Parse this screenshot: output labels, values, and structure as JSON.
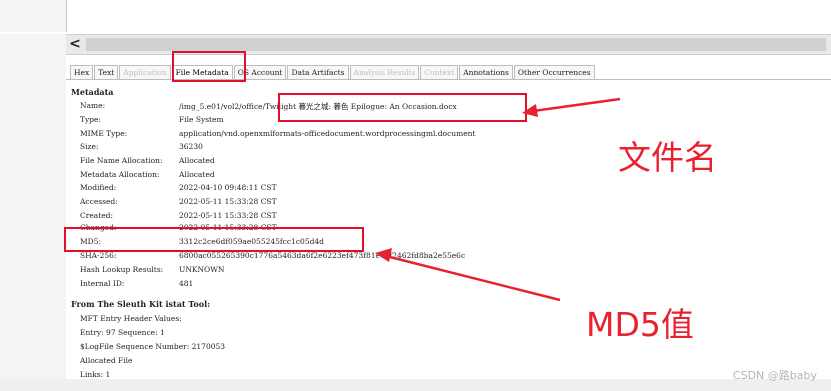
{
  "tabs": [
    {
      "label": "Hex",
      "state": "normal"
    },
    {
      "label": "Text",
      "state": "normal"
    },
    {
      "label": "Application",
      "state": "disabled"
    },
    {
      "label": "File Metadata",
      "state": "active"
    },
    {
      "label": "OS Account",
      "state": "normal"
    },
    {
      "label": "Data Artifacts",
      "state": "normal"
    },
    {
      "label": "Analysis Results",
      "state": "disabled"
    },
    {
      "label": "Context",
      "state": "disabled"
    },
    {
      "label": "Annotations",
      "state": "normal"
    },
    {
      "label": "Other Occurrences",
      "state": "normal"
    }
  ],
  "scroll_left_glyph": "<",
  "metadata": {
    "heading": "Metadata",
    "name_label": "Name:",
    "name_path": "/img_5.e01/vol2/office/",
    "name_file": "Twilight 暮光之城: 暮色 Epilogue: An Occasion.docx",
    "type_label": "Type:",
    "type_value": "File System",
    "mime_label": "MIME Type:",
    "mime_value": "application/vnd.openxmlformats-officedocument.wordprocessingml.document",
    "size_label": "Size:",
    "size_value": "36230",
    "fna_label": "File Name Allocation:",
    "fna_value": "Allocated",
    "mda_label": "Metadata Allocation:",
    "mda_value": "Allocated",
    "modified_label": "Modified:",
    "modified_value": "2022-04-10 09:48:11 CST",
    "accessed_label": "Accessed:",
    "accessed_value": "2022-05-11 15:33:28 CST",
    "created_label": "Created:",
    "created_value": "2022-05-11 15:33:28 CST",
    "changed_label": "Changed:",
    "changed_value": "2022-05-11 15:33:28 CST",
    "md5_label": "MD5:",
    "md5_value": "3312c2ce6df059ae055245fcc1c05d4d",
    "sha_label": "SHA-256:",
    "sha_value": "6800ac055265390c1776a5463da6f2e6223ef473f81e73f2462fd8ba2e55e6c",
    "hash_label": "Hash Lookup Results:",
    "hash_value": "UNKNOWN",
    "iid_label": "Internal ID:",
    "iid_value": "481"
  },
  "istat": {
    "heading": "From The Sleuth Kit istat Tool:",
    "lines": [
      "MFT Entry Header Values:",
      "Entry: 97 Sequence: 1",
      "$LogFile Sequence Number: 2170053",
      "Allocated File",
      "Links: 1"
    ]
  },
  "annotations": {
    "filename_label": "文件名",
    "md5_label": "MD5值",
    "color": "#e8212f"
  },
  "watermark": "CSDN @路baby"
}
